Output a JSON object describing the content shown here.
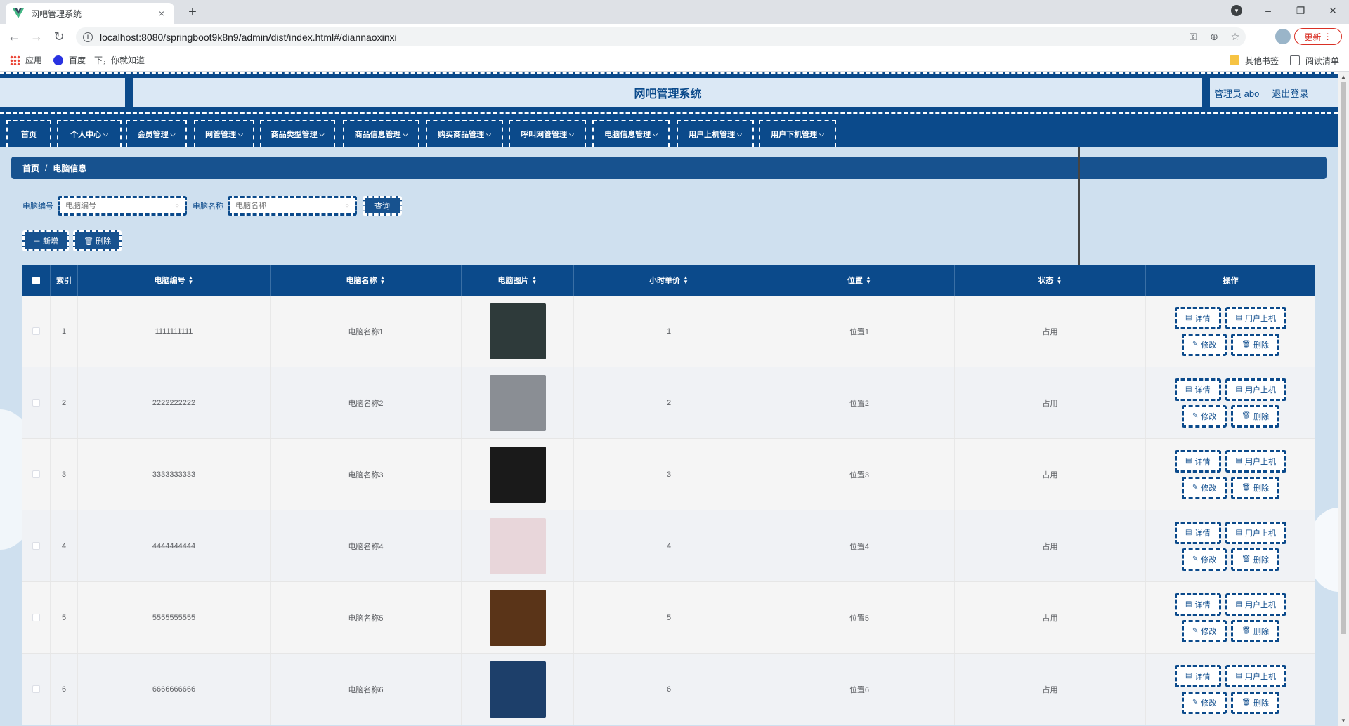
{
  "browser": {
    "tab_title": "网吧管理系统",
    "tab_close": "×",
    "new_tab": "+",
    "url": "localhost:8080/springboot9k8n9/admin/dist/index.html#/diannaoxinxi",
    "update_label": "更新",
    "win_min": "–",
    "win_max": "❐",
    "win_close": "✕"
  },
  "bookmarks": {
    "apps": "应用",
    "baidu": "百度一下，你就知道",
    "other": "其他书签",
    "reader": "阅读清单"
  },
  "header": {
    "title": "网吧管理系统",
    "user": "管理员 abo",
    "logout": "退出登录"
  },
  "menu": [
    {
      "label": "首页",
      "has_dropdown": false
    },
    {
      "label": "个人中心",
      "has_dropdown": true
    },
    {
      "label": "会员管理",
      "has_dropdown": true
    },
    {
      "label": "网管管理",
      "has_dropdown": true
    },
    {
      "label": "商品类型管理",
      "has_dropdown": true
    },
    {
      "label": "商品信息管理",
      "has_dropdown": true
    },
    {
      "label": "购买商品管理",
      "has_dropdown": true
    },
    {
      "label": "呼叫网管管理",
      "has_dropdown": true
    },
    {
      "label": "电脑信息管理",
      "has_dropdown": true
    },
    {
      "label": "用户上机管理",
      "has_dropdown": true
    },
    {
      "label": "用户下机管理",
      "has_dropdown": true
    }
  ],
  "breadcrumb": {
    "home": "首页",
    "separator": "/",
    "current": "电脑信息"
  },
  "search": {
    "code_label": "电脑编号",
    "code_placeholder": "电脑编号",
    "name_label": "电脑名称",
    "name_placeholder": "电脑名称",
    "query_button": "查询"
  },
  "actions": {
    "add": "新增",
    "delete": "删除"
  },
  "table": {
    "columns": [
      "索引",
      "电脑编号",
      "电脑名称",
      "电脑图片",
      "小时单价",
      "位置",
      "状态",
      "操作"
    ],
    "row_actions": {
      "detail": "详情",
      "user_on": "用户上机",
      "edit": "修改",
      "delete": "删除"
    },
    "rows": [
      {
        "index": "1",
        "code": "1111111111",
        "name": "电脑名称1",
        "price": "1",
        "location": "位置1",
        "status": "占用",
        "image_color": "#2e3a3a"
      },
      {
        "index": "2",
        "code": "2222222222",
        "name": "电脑名称2",
        "price": "2",
        "location": "位置2",
        "status": "占用",
        "image_color": "#8a8e94"
      },
      {
        "index": "3",
        "code": "3333333333",
        "name": "电脑名称3",
        "price": "3",
        "location": "位置3",
        "status": "占用",
        "image_color": "#1a1a1a"
      },
      {
        "index": "4",
        "code": "4444444444",
        "name": "电脑名称4",
        "price": "4",
        "location": "位置4",
        "status": "占用",
        "image_color": "#e8d6da"
      },
      {
        "index": "5",
        "code": "5555555555",
        "name": "电脑名称5",
        "price": "5",
        "location": "位置5",
        "status": "占用",
        "image_color": "#5a3418"
      },
      {
        "index": "6",
        "code": "6666666666",
        "name": "电脑名称6",
        "price": "6",
        "location": "位置6",
        "status": "占用",
        "image_color": "#1d3f6a"
      }
    ]
  },
  "colors": {
    "primary": "#0b4a8b",
    "page_bg": "#cfe0ef"
  }
}
